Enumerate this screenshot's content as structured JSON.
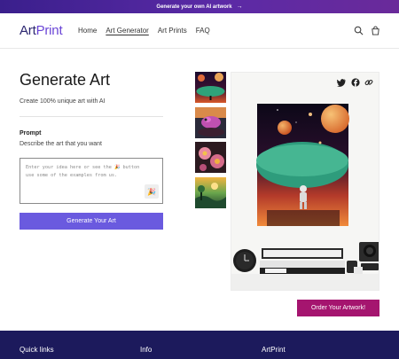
{
  "announcement": {
    "text": "Generate your own AI artwork",
    "arrow": "→"
  },
  "header": {
    "logo_part1": "Art",
    "logo_part2": "Print",
    "nav": [
      "Home",
      "Art Generator",
      "Art Prints",
      "FAQ"
    ]
  },
  "main": {
    "title": "Generate Art",
    "subtitle": "Create 100% unique art with AI",
    "prompt_label": "Prompt",
    "prompt_desc": "Describe the art that you want",
    "textarea_placeholder": "Enter your idea here or see the 🎉 button use some of the examples from us.",
    "magic_icon": "🎉",
    "generate_button": "Generate Your Art",
    "order_button": "Order Your Artwork!"
  },
  "share_icons": [
    "twitter-icon",
    "facebook-icon",
    "link-icon"
  ],
  "colors": {
    "announcement_bar": "#4a27a0",
    "logo_dark": "#2b2670",
    "logo_accent": "#6a45d6",
    "generate_button": "#6a5adf",
    "order_button": "#a5156f",
    "footer": "#1c1a5c"
  },
  "footer": {
    "columns": [
      "Quick links",
      "Info",
      "ArtPrint"
    ]
  }
}
